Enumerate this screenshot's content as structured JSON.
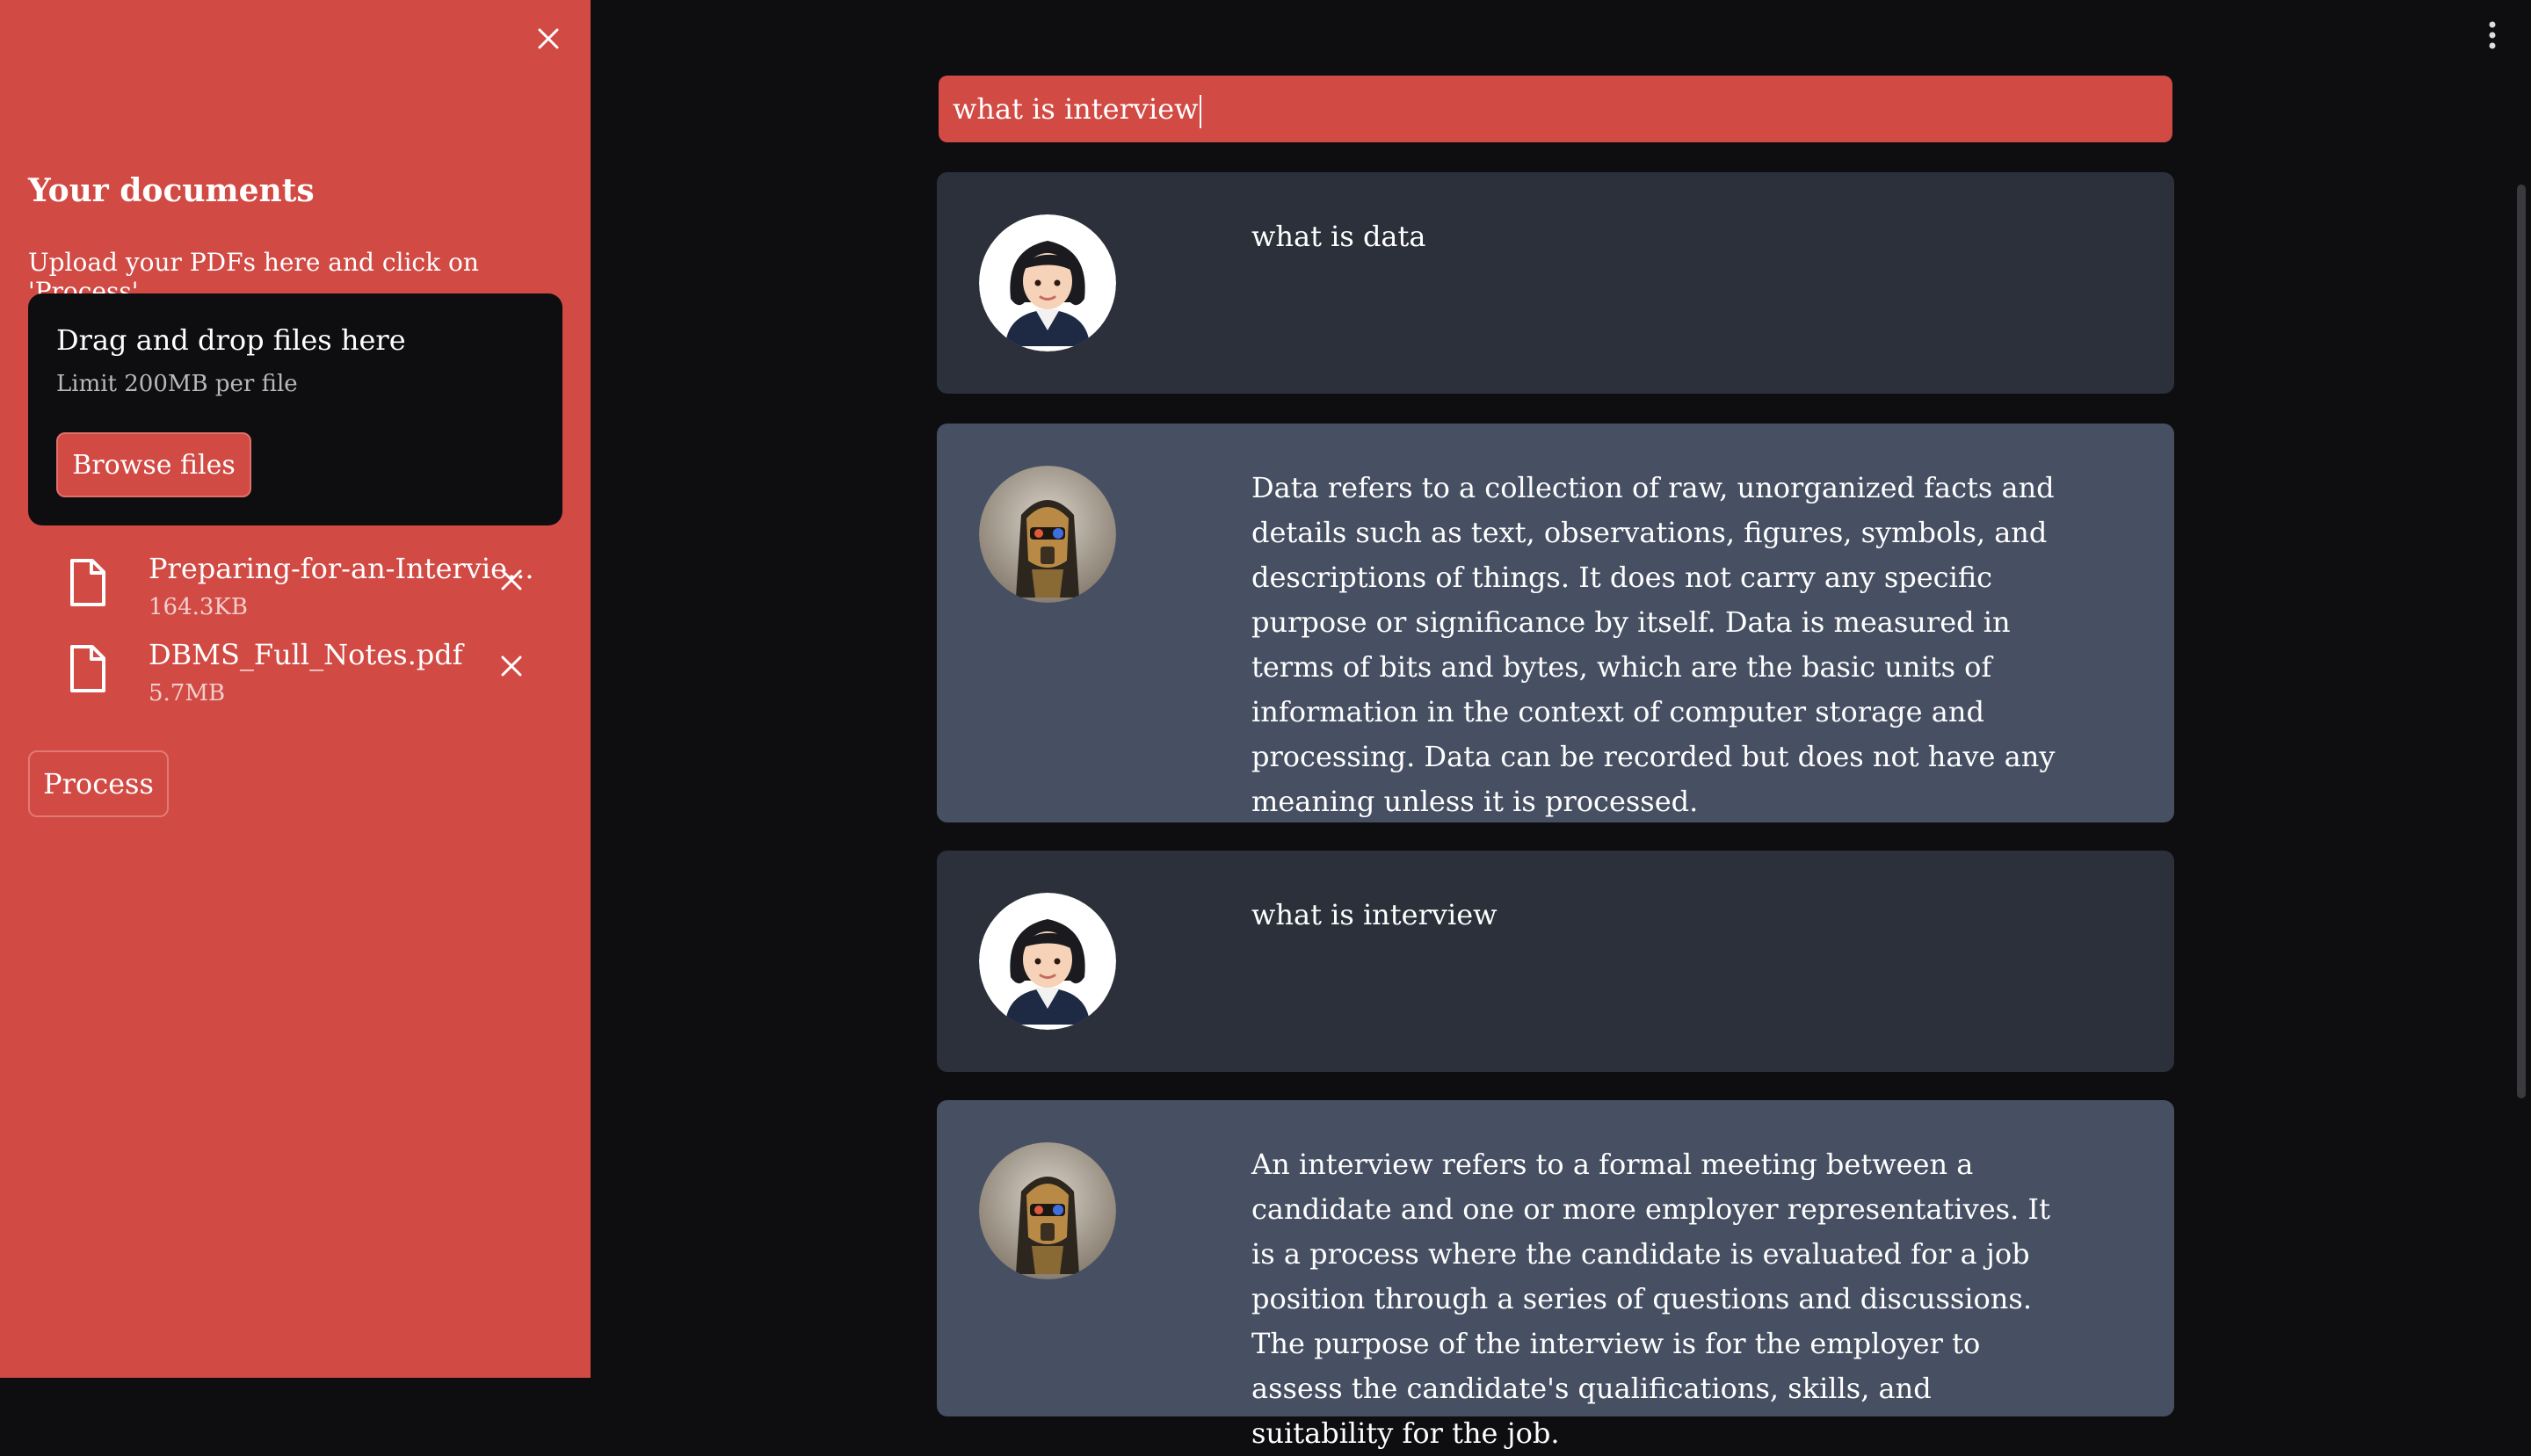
{
  "sidebar": {
    "title": "Your documents",
    "subtitle": "Upload your PDFs here and click on 'Process'",
    "dropzone": {
      "title": "Drag and drop files here",
      "limit": "Limit 200MB per file",
      "browse_label": "Browse files"
    },
    "files": [
      {
        "name": "Preparing-for-an-Intervie...",
        "size": "164.3KB"
      },
      {
        "name": "DBMS_Full_Notes.pdf",
        "size": "5.7MB"
      }
    ],
    "process_label": "Process"
  },
  "query": {
    "value": "what is interview"
  },
  "messages": [
    {
      "role": "user",
      "text": "what is data"
    },
    {
      "role": "bot",
      "text": "Data refers to a collection of raw, unorganized facts and details such as text, observations, figures, symbols, and descriptions of things. It does not carry any specific purpose or significance by itself. Data is measured in terms of bits and bytes, which are the basic units of information in the context of computer storage and processing. Data can be recorded but does not have any meaning unless it is processed."
    },
    {
      "role": "user",
      "text": "what is interview"
    },
    {
      "role": "bot",
      "text": "An interview refers to a formal meeting between a candidate and one or more employer representatives. It is a process where the candidate is evaluated for a job position through a series of questions and discussions. The purpose of the interview is for the employer to assess the candidate's qualifications, skills, and suitability for the job."
    }
  ],
  "colors": {
    "sidebar": "#d14a44",
    "background": "#0e0e10",
    "user_bubble": "#2b303b",
    "bot_bubble": "#475063"
  },
  "icons": [
    "close-icon",
    "file-icon",
    "remove-file-icon",
    "more-options-icon",
    "user-avatar",
    "bot-avatar"
  ]
}
